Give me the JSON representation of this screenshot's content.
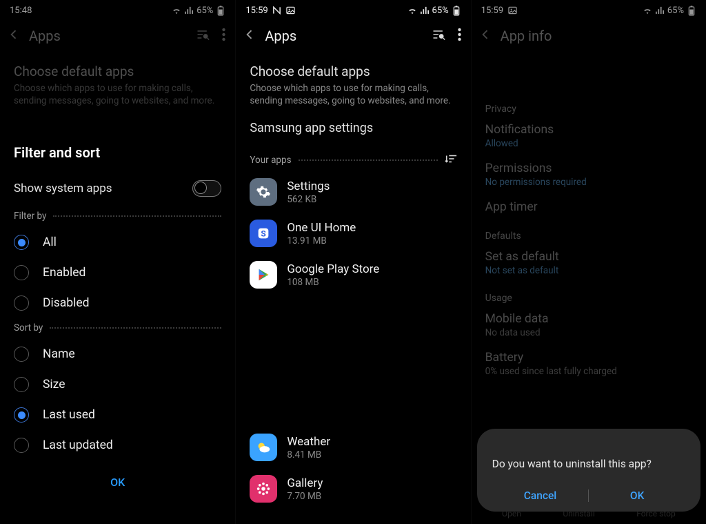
{
  "panes": [
    {
      "status": {
        "time": "15:48",
        "battery": "65%"
      },
      "header": {
        "title": "Apps"
      },
      "default_section": {
        "title": "Choose default apps",
        "sub": "Choose which apps to use for making calls, sending messages, going to websites, and more."
      },
      "panel_title": "Filter and sort",
      "toggle_label": "Show system apps",
      "filter_label": "Filter by",
      "filter_options": [
        "All",
        "Enabled",
        "Disabled"
      ],
      "filter_selected": 0,
      "sort_label": "Sort by",
      "sort_options": [
        "Name",
        "Size",
        "Last used",
        "Last updated"
      ],
      "sort_selected": 2,
      "ok": "OK"
    },
    {
      "status": {
        "time": "15:59",
        "battery": "65%"
      },
      "header": {
        "title": "Apps"
      },
      "default_section": {
        "title": "Choose default apps",
        "sub": "Choose which apps to use for making calls, sending messages, going to websites, and more."
      },
      "samsung_link": "Samsung app settings",
      "your_apps_label": "Your apps",
      "apps_top": [
        {
          "name": "Settings",
          "size": "562 KB",
          "icon": "settings",
          "bg": "#5e6e80"
        },
        {
          "name": "One UI Home",
          "size": "13.91 MB",
          "icon": "oneui",
          "bg": "#2a5be0"
        },
        {
          "name": "Google Play Store",
          "size": "108 MB",
          "icon": "play",
          "bg": "#ffffff"
        }
      ],
      "apps_bottom": [
        {
          "name": "Weather",
          "size": "8.41 MB",
          "icon": "weather",
          "bg": "#3aa3ff"
        },
        {
          "name": "Gallery",
          "size": "7.70 MB",
          "icon": "gallery",
          "bg": "#e1306c"
        }
      ]
    },
    {
      "status": {
        "time": "15:59",
        "battery": "65%"
      },
      "header": {
        "title": "App info"
      },
      "groups": [
        {
          "label": "Privacy",
          "items": [
            {
              "title": "Notifications",
              "sub": "Allowed",
              "subtype": "link"
            },
            {
              "title": "Permissions",
              "sub": "No permissions required",
              "subtype": "link"
            },
            {
              "title": "App timer",
              "sub": "",
              "subtype": "none"
            }
          ]
        },
        {
          "label": "Defaults",
          "items": [
            {
              "title": "Set as default",
              "sub": "Not set as default",
              "subtype": "link"
            }
          ]
        },
        {
          "label": "Usage",
          "items": [
            {
              "title": "Mobile data",
              "sub": "No data used",
              "subtype": "gray"
            },
            {
              "title": "Battery",
              "sub": "0% used since last fully charged",
              "subtype": "gray"
            }
          ]
        }
      ],
      "bottom_actions": [
        "Open",
        "Uninstall",
        "Force stop"
      ],
      "dialog": {
        "text": "Do you want to uninstall this app?",
        "cancel": "Cancel",
        "ok": "OK"
      }
    }
  ]
}
